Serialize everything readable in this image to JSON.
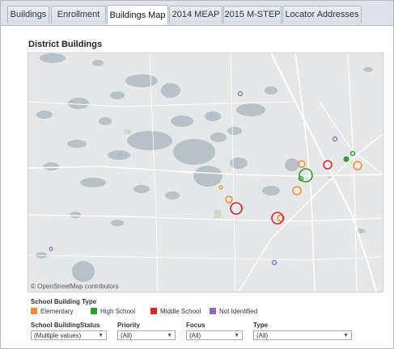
{
  "tabs": [
    {
      "label": "Buildings",
      "active": false
    },
    {
      "label": "Enrollment",
      "active": false
    },
    {
      "label": "Buildings Map",
      "active": true
    },
    {
      "label": "2014 MEAP",
      "active": false
    },
    {
      "label": "2015 M-STEP",
      "active": false
    },
    {
      "label": "Locator Addresses",
      "active": false
    }
  ],
  "page_title": "District Buildings",
  "map": {
    "attribution": "© OpenStreetMap contributors",
    "colors": {
      "land": "#e6e7e8",
      "water": "#b7c2c8",
      "road": "#ffffff",
      "park": "#c9dcc5"
    }
  },
  "legend": {
    "title": "School Building Type",
    "items": [
      {
        "label": "Elementary",
        "color": "#f28e2b"
      },
      {
        "label": "High School",
        "color": "#2ca02c"
      },
      {
        "label": "Middle School",
        "color": "#d62728"
      },
      {
        "label": "Not Identified",
        "color": "#9467bd"
      }
    ]
  },
  "filters": [
    {
      "label": "School BuildingStatus",
      "value": "(Multiple values)"
    },
    {
      "label": "Priority",
      "value": "(All)"
    },
    {
      "label": "Focus",
      "value": "(All)"
    },
    {
      "label": "Type",
      "value": "(All)"
    }
  ]
}
